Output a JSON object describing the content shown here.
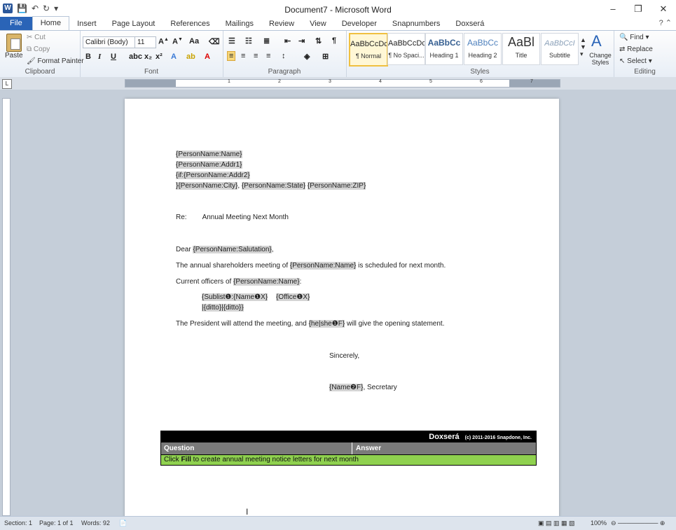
{
  "window": {
    "title": "Document7 - Microsoft Word",
    "minimize": "–",
    "restore": "❐",
    "close": "✕"
  },
  "quick_access": {
    "logo": "W",
    "save": "💾",
    "undo": "↶",
    "redo": "↻",
    "customize": "▾"
  },
  "tabs": [
    "File",
    "Home",
    "Insert",
    "Page Layout",
    "References",
    "Mailings",
    "Review",
    "View",
    "Developer",
    "Snapnumbers",
    "Doxserá"
  ],
  "help": "? ⌃",
  "ribbon": {
    "clipboard": {
      "label": "Clipboard",
      "paste": "Paste",
      "cut": "Cut",
      "copy": "Copy",
      "format_painter": "Format Painter"
    },
    "font": {
      "label": "Font",
      "name": "Calibri (Body)",
      "size": "11",
      "bold": "B",
      "italic": "I",
      "underline": "U"
    },
    "paragraph": {
      "label": "Paragraph"
    },
    "styles": {
      "label": "Styles",
      "items": [
        {
          "sample": "AaBbCcDc",
          "name": "¶ Normal"
        },
        {
          "sample": "AaBbCcDc",
          "name": "¶ No Spaci..."
        },
        {
          "sample": "AaBbCc",
          "name": "Heading 1"
        },
        {
          "sample": "AaBbCc",
          "name": "Heading 2"
        },
        {
          "sample": "AaBl",
          "name": "Title"
        },
        {
          "sample": "AaBbCcI",
          "name": "Subtitle"
        }
      ],
      "change_styles": "Change Styles"
    },
    "editing": {
      "label": "Editing",
      "find": "Find",
      "replace": "Replace",
      "select": "Select"
    }
  },
  "ruler": {
    "numbers": [
      "1",
      "2",
      "3",
      "4",
      "5",
      "6",
      "7"
    ]
  },
  "document": {
    "addr_name": "{PersonName:Name}",
    "addr1": "{PersonName:Addr1}",
    "addr2": "{if:{PersonName:Addr2}",
    "city_line_open": "}",
    "city": "{PersonName:City}",
    "state": "{PersonName:State}",
    "zip": "{PersonName:ZIP}",
    "re_label": "Re:",
    "re_text": "Annual Meeting Next Month",
    "dear": "Dear",
    "salutation": "{PersonName:Salutation}",
    "p1_a": "The annual shareholders meeting of",
    "p1_field": "{PersonName:Name}",
    "p1_b": "is scheduled for next month.",
    "p2_a": "Current officers of",
    "p2_field": "{PersonName:Name}",
    "sub1": "{Sublist❶:{Name❶X}",
    "sub2": "{Office❶X}",
    "ditto": "|{ditto}|{ditto}}",
    "p3_a": "The President will attend the meeting, and",
    "p3_field": "{he|she❶F}",
    "p3_b": "will give the opening statement.",
    "sincerely": "Sincerely,",
    "sig_field": "{Name❷F}",
    "sig_title": ", Secretary"
  },
  "doxsera": {
    "brand": "Doxserá",
    "copyright": "(c) 2011-2016 Snapdone, Inc.",
    "col_question": "Question",
    "col_answer": "Answer",
    "instr_a": "Click ",
    "instr_bold": "Fill",
    "instr_b": " to create annual meeting notice letters for next month"
  },
  "status": {
    "section": "Section: 1",
    "page": "Page: 1 of 1",
    "words": "Words: 92",
    "zoom": "100%"
  }
}
